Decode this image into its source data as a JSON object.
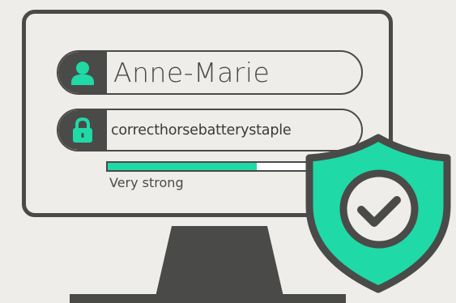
{
  "login": {
    "username_value": "Anne-Marie",
    "password_value": "correcthorsebatterystaple",
    "password_strength_label": "Very strong",
    "password_strength_fraction": 0.74
  },
  "icons": {
    "username_field_icon": "user-icon",
    "password_field_icon": "padlock-icon",
    "security_badge_icon": "shield-checkmark-icon"
  },
  "colors": {
    "accent": "#1fd9a6",
    "dark": "#4a4a48",
    "background": "#eeede9",
    "meter_empty": "#ffffff"
  }
}
